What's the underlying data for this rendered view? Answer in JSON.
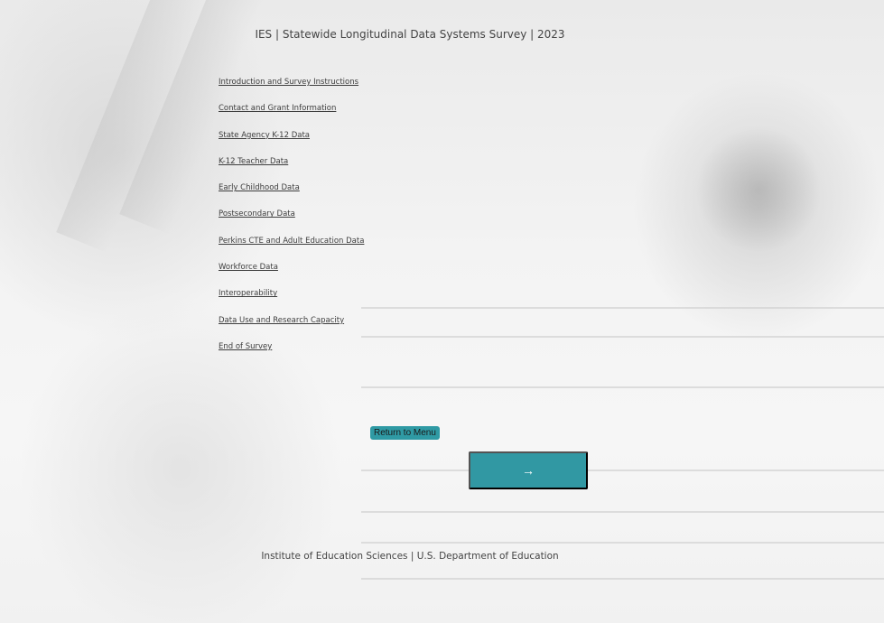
{
  "header": {
    "title": "IES | Statewide Longitudinal Data Systems Survey | 2023"
  },
  "menu": {
    "items": [
      {
        "label": "Introduction and Survey Instructions"
      },
      {
        "label": "Contact and Grant Information"
      },
      {
        "label": "State Agency K-12 Data"
      },
      {
        "label": "K-12 Teacher Data"
      },
      {
        "label": "Early Childhood Data"
      },
      {
        "label": "Postsecondary Data"
      },
      {
        "label": "Perkins CTE and Adult Education Data"
      },
      {
        "label": "Workforce Data"
      },
      {
        "label": "Interoperability"
      },
      {
        "label": "Data Use and Research Capacity"
      },
      {
        "label": "End of Survey"
      }
    ]
  },
  "buttons": {
    "return_label": "Return to Menu",
    "next_label": "→"
  },
  "footer": {
    "text": "Institute of Education Sciences | U.S. Department of Education"
  },
  "colors": {
    "accent": "#3198a3",
    "text": "#333333"
  }
}
